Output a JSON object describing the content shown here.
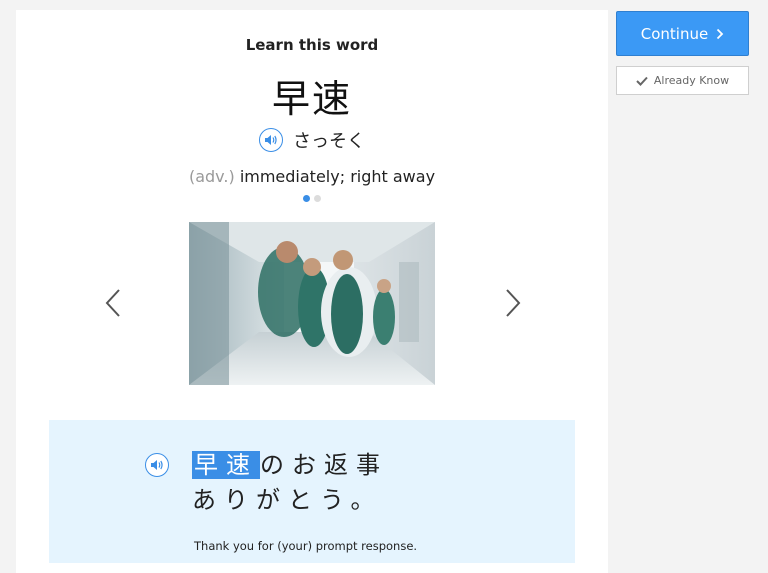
{
  "card": {
    "heading": "Learn this word",
    "word": "早速",
    "reading": "さっそく",
    "part_of_speech": "(adv.)",
    "meaning": "immediately; right away",
    "pagination": {
      "current": 1,
      "total": 2
    }
  },
  "example": {
    "highlight": "早速",
    "rest_line1": "のお返事",
    "line2": "ありがとう。",
    "translation": "Thank you for (your) prompt response."
  },
  "actions": {
    "continue_label": "Continue",
    "already_know_label": "Already Know"
  },
  "colors": {
    "accent": "#3a8ee6",
    "continue_bg": "#3b99f5",
    "sentence_bg": "#e5f4fe"
  },
  "icons": [
    "speaker-icon",
    "chevron-left-icon",
    "chevron-right-icon",
    "chevron-right-small-icon",
    "checkmark-icon"
  ]
}
